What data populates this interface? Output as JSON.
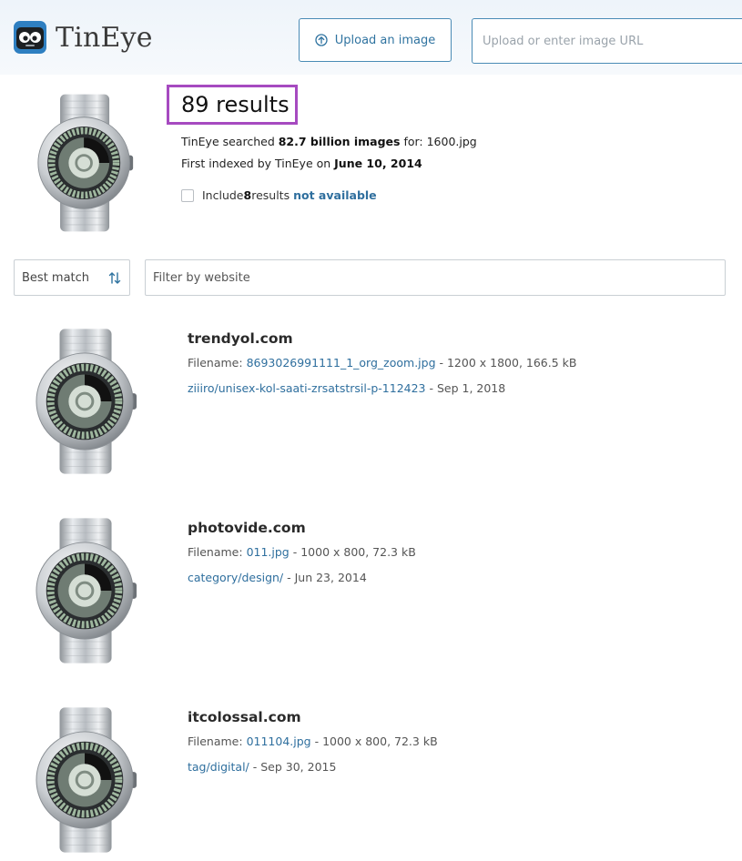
{
  "header": {
    "logo_text": "TinEye",
    "upload_button": "Upload an image",
    "url_placeholder": "Upload or enter image URL"
  },
  "summary": {
    "count_label": "89 results",
    "searched_prefix": "TinEye searched ",
    "searched_amount": "82.7 billion images",
    "searched_for": " for: ",
    "query_file": "1600.jpg",
    "indexed_prefix": "First indexed by TinEye on ",
    "indexed_date": "June 10, 2014",
    "include_prefix": "Include ",
    "include_count": "8",
    "include_mid": " results",
    "include_link": "not available"
  },
  "controls": {
    "sort_value": "Best match",
    "filter_placeholder": "Filter by website"
  },
  "results": [
    {
      "domain": "trendyol.com",
      "filename_label": "Filename: ",
      "filename": "8693026991111_1_org_zoom.jpg",
      "file_info": " - 1200 x 1800, 166.5 kB",
      "page_link": "ziiiro/unisex-kol-saati-zrsatstrsil-p-112423",
      "page_date": " - Sep 1, 2018"
    },
    {
      "domain": "photovide.com",
      "filename_label": "Filename: ",
      "filename": "011.jpg",
      "file_info": " - 1000 x 800, 72.3 kB",
      "page_link": "category/design/",
      "page_date": " - Jun 23, 2014"
    },
    {
      "domain": "itcolossal.com",
      "filename_label": "Filename: ",
      "filename": "011104.jpg",
      "file_info": " - 1000 x 800, 72.3 kB",
      "page_link": "tag/digital/",
      "page_date": " - Sep 30, 2015"
    }
  ],
  "colors": {
    "highlight_border": "#a64ac0",
    "link": "#2f6f9e",
    "header_bg": "#eef4fa"
  },
  "icons": {
    "logo": "robot-logo-icon",
    "upload": "upload-arrow-icon",
    "sort": "sort-arrows-icon",
    "thumbnail": "watch-thumbnail"
  }
}
